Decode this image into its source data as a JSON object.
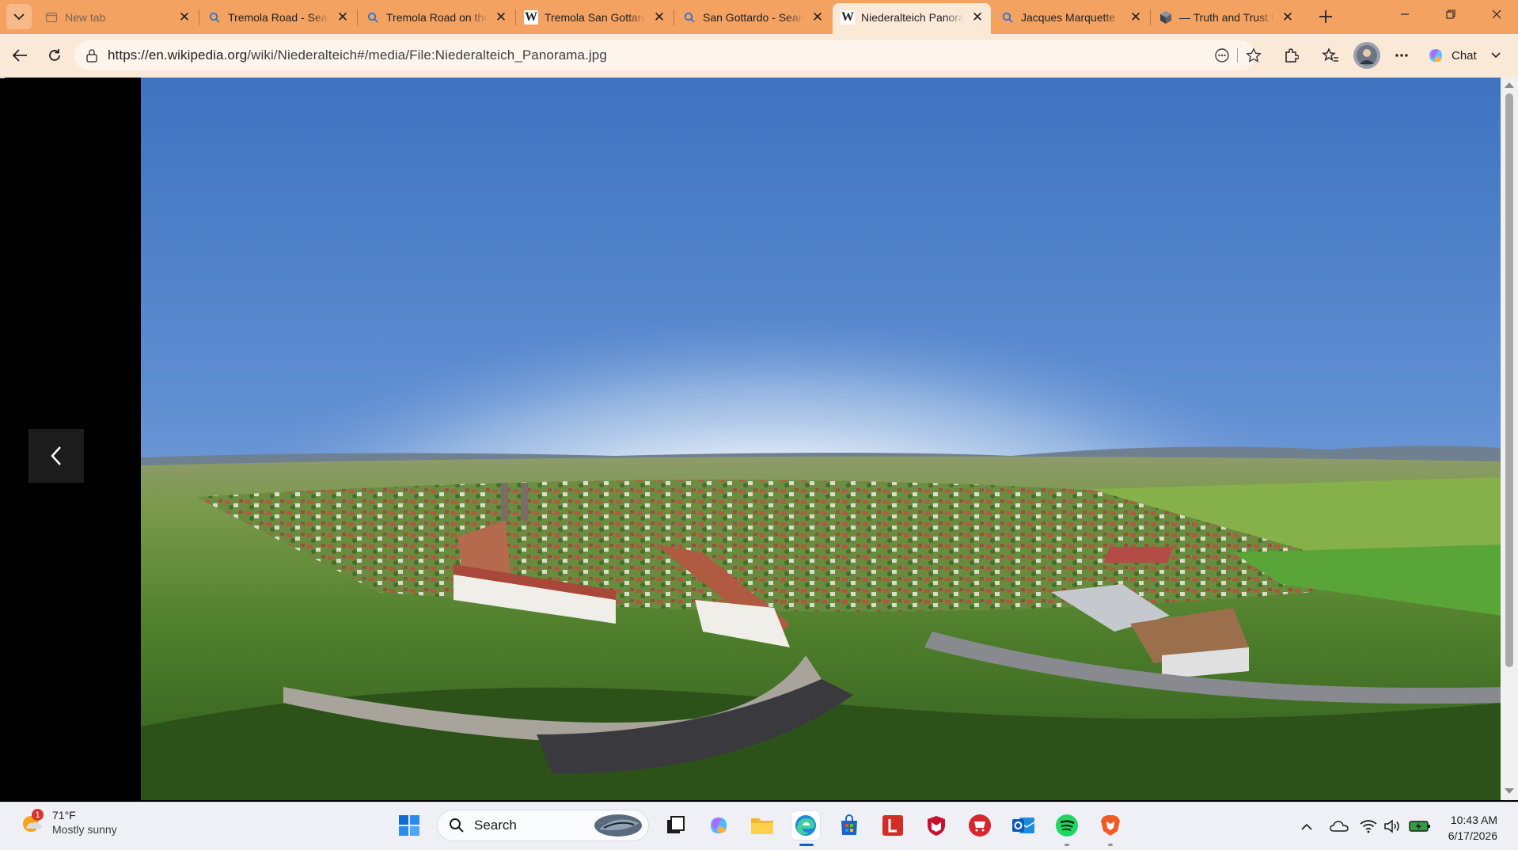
{
  "browser": {
    "tabs": [
      {
        "title": "New tab",
        "icon": "new-tab-icon",
        "active": false
      },
      {
        "title": "Tremola Road - Search",
        "icon": "search-icon",
        "active": false
      },
      {
        "title": "Tremola Road on the San Gottardo",
        "icon": "search-icon",
        "active": false
      },
      {
        "title": "Tremola San Gottardo - Wikipedia",
        "icon": "wikipedia-icon",
        "active": false
      },
      {
        "title": "San Gottardo - Search",
        "icon": "search-icon",
        "active": false
      },
      {
        "title": "Niederalteich Panorama",
        "icon": "wikipedia-icon",
        "active": true
      },
      {
        "title": "Jacques Marquette",
        "icon": "search-icon",
        "active": false
      },
      {
        "title": "— Truth and Trust for",
        "icon": "cube-icon",
        "active": false
      }
    ],
    "url": "https://en.wikipedia.org/wiki/Niederalteich#/media/File:Niederalteich_Panorama.jpg",
    "url_host": "https://en.wikipedia.org",
    "url_path": "/wiki/Niederalteich#/media/File:Niederalteich_Panorama.jpg",
    "chat_label": "Chat",
    "accent": "#f4a261"
  },
  "viewer": {
    "image_file": "Niederalteich_Panorama.jpg",
    "prev_button": "chevron-left-icon"
  },
  "taskbar": {
    "weather": {
      "temp": "71°F",
      "desc": "Mostly sunny",
      "badge": "1"
    },
    "search_placeholder": "Search",
    "apps": [
      "windows-start",
      "search",
      "task-view",
      "copilot",
      "file-explorer",
      "edge",
      "microsoft-store",
      "lastpass",
      "mcafee",
      "cart-app",
      "outlook",
      "spotify",
      "brave"
    ],
    "clock_time": "10:43 AM",
    "clock_date": "6/17/2026"
  }
}
